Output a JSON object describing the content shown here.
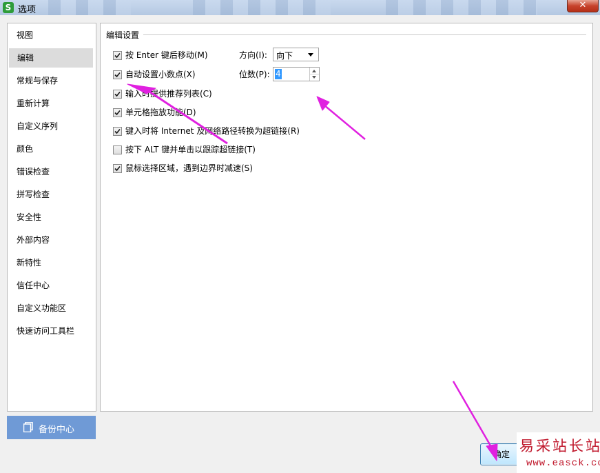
{
  "window": {
    "title": "选项",
    "app_icon_letter": "S",
    "close_glyph": "✕"
  },
  "sidebar": {
    "items": [
      {
        "label": "视图"
      },
      {
        "label": "编辑",
        "active": true
      },
      {
        "label": "常规与保存"
      },
      {
        "label": "重新计算"
      },
      {
        "label": "自定义序列"
      },
      {
        "label": "颜色"
      },
      {
        "label": "错误检查"
      },
      {
        "label": "拼写检查"
      },
      {
        "label": "安全性"
      },
      {
        "label": "外部内容"
      },
      {
        "label": "新特性"
      },
      {
        "label": "信任中心"
      },
      {
        "label": "自定义功能区"
      },
      {
        "label": "快速访问工具栏"
      }
    ],
    "backup_label": "备份中心"
  },
  "edit_settings": {
    "section_title": "编辑设置",
    "options": [
      {
        "label": "按 Enter 键后移动(M)",
        "checked": true
      },
      {
        "label": "自动设置小数点(X)",
        "checked": true
      },
      {
        "label": "输入时提供推荐列表(C)",
        "checked": true
      },
      {
        "label": "单元格拖放功能(D)",
        "checked": true
      },
      {
        "label": "键入时将 Internet 及网络路径转换为超链接(R)",
        "checked": true
      },
      {
        "label": "按下 ALT 键并单击以跟踪超链接(T)",
        "checked": false
      },
      {
        "label": "鼠标选择区域，遇到边界时减速(S)",
        "checked": true
      }
    ],
    "direction": {
      "label": "方向(I):",
      "value": "向下"
    },
    "places": {
      "label": "位数(P):",
      "value": "4"
    }
  },
  "footer": {
    "ok_label": "确定"
  },
  "watermark": {
    "title": "易采站长站",
    "url": "www.easck.com"
  },
  "colors": {
    "annotation_arrow": "#e020e0",
    "backup_button": "#6f9ad6",
    "watermark_red": "#c0182c"
  }
}
